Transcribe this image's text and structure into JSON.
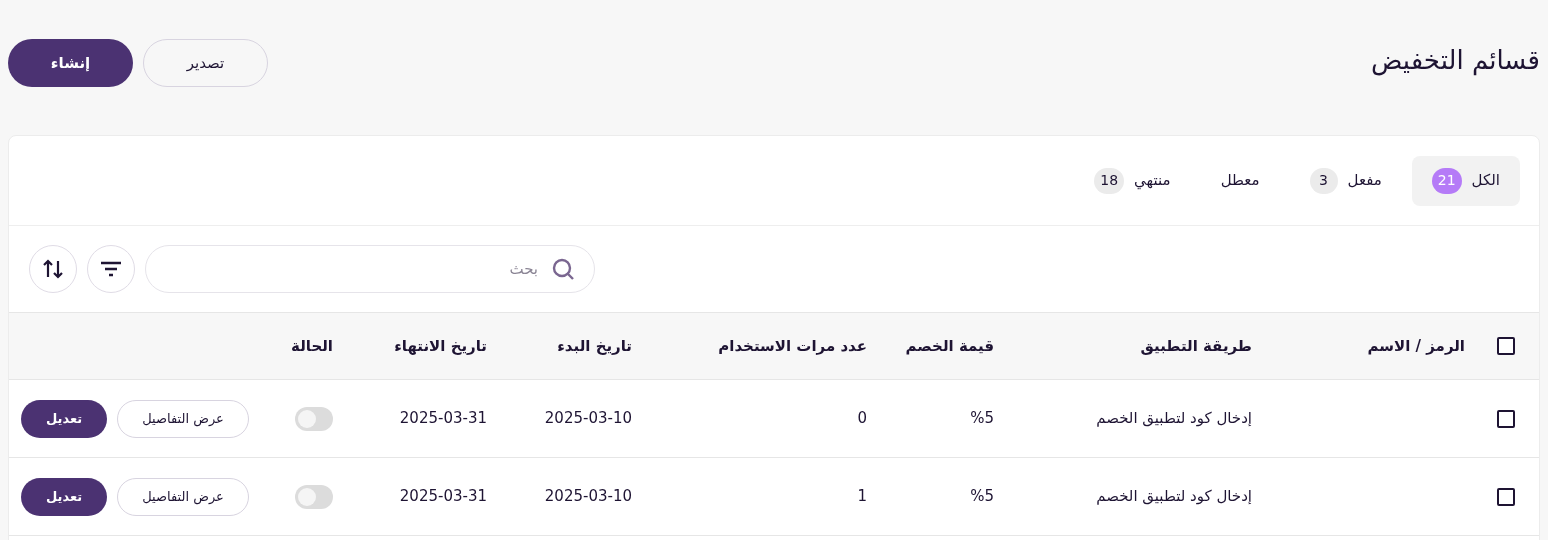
{
  "page": {
    "title": "قسائم التخفيض",
    "buttons": [
      {
        "label": "تصدير",
        "kind": "outline"
      },
      {
        "label": "إنشاء",
        "kind": "primary"
      }
    ]
  },
  "tabs": [
    {
      "label": "الكل",
      "count": "21",
      "selected": true
    },
    {
      "label": "مفعل",
      "count": "3",
      "selected": false
    },
    {
      "label": "معطل",
      "selected": false
    },
    {
      "label": "منتهي",
      "count": "18",
      "selected": false
    }
  ],
  "search": {
    "placeholder": "بحث"
  },
  "table": {
    "select_all": {
      "checked": false
    },
    "columns": [
      "الرمز / الاسم",
      "طريقة التطبيق",
      "قيمة الخصم",
      "عدد مرات الاستخدام",
      "تاريخ البدء",
      "تاريخ الانتهاء",
      "الحالة"
    ],
    "rows": [
      {
        "checked": false,
        "method": "إدخال كود لتطبيق الخصم",
        "value": "%5",
        "uses": "0",
        "start": "2025-03-10",
        "end": "2025-03-31",
        "on": false,
        "actions": [
          "عرض التفاصيل",
          "تعديل"
        ]
      },
      {
        "checked": false,
        "method": "إدخال كود لتطبيق الخصم",
        "value": "%5",
        "uses": "1",
        "start": "2025-03-10",
        "end": "2025-03-31",
        "on": false,
        "actions": [
          "عرض التفاصيل",
          "تعديل"
        ]
      }
    ]
  }
}
